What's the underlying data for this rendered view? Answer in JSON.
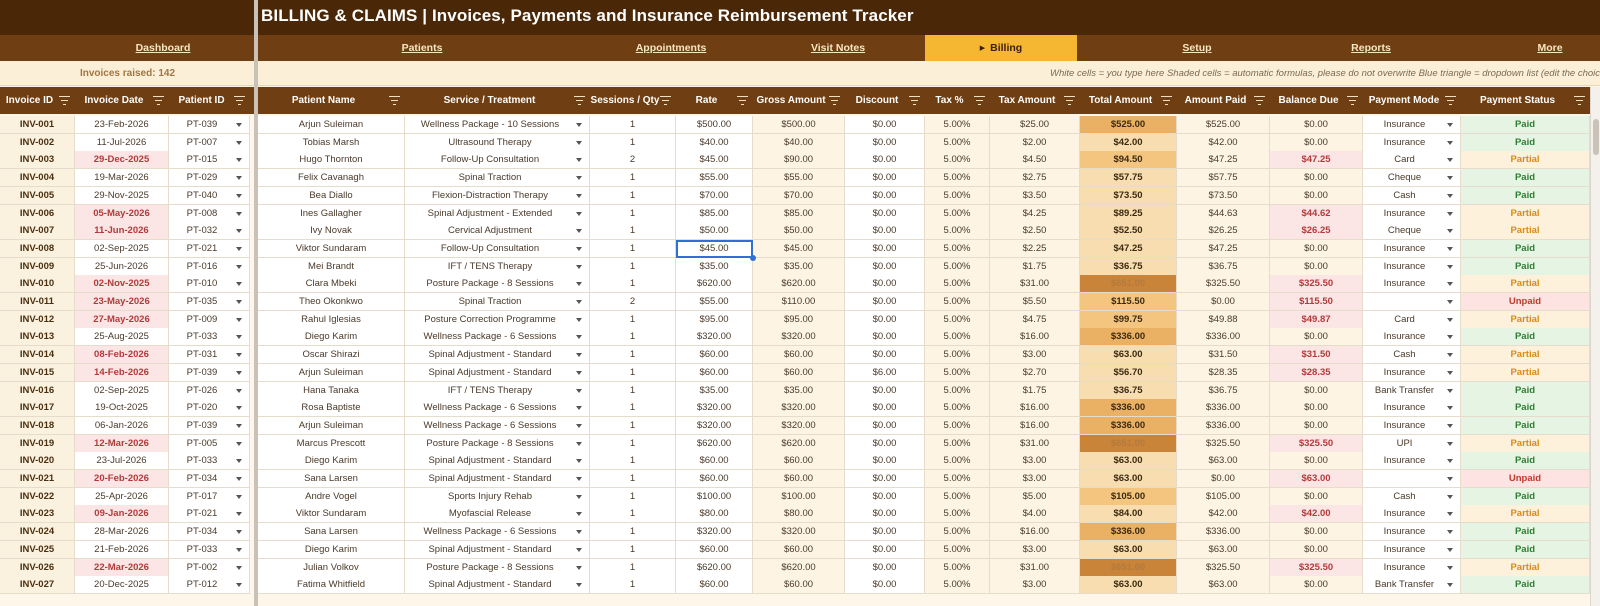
{
  "header": {
    "title": "BILLING & CLAIMS  |  Invoices, Payments and Insurance Reimbursement Tracker"
  },
  "nav": [
    {
      "label": "Dashboard",
      "active": false
    },
    {
      "label": "Patients",
      "active": false
    },
    {
      "label": "Appointments",
      "active": false
    },
    {
      "label": "Visit Notes",
      "active": false
    },
    {
      "label": "Billing",
      "active": true
    },
    {
      "label": "Setup",
      "active": false
    },
    {
      "label": "Reports",
      "active": false
    },
    {
      "label": "More",
      "active": false
    }
  ],
  "info": {
    "invoices_raised": "Invoices raised: 142",
    "legend": "White cells = you type here      Shaded cells = automatic formulas, please do not overwrite      Blue triangle = dropdown list (edit the choic"
  },
  "columns": [
    "Invoice ID",
    "Invoice Date",
    "Patient ID",
    "Patient Name",
    "Service / Treatment",
    "Sessions / Qty",
    "Rate",
    "Gross Amount",
    "Discount",
    "Tax %",
    "Tax Amount",
    "Total Amount",
    "Amount Paid",
    "Balance Due",
    "Payment Mode",
    "Payment Status"
  ],
  "rows": [
    [
      "INV-001",
      "23-Feb-2026",
      "PT-039",
      "Arjun Suleiman",
      "Wellness Package - 10 Sessions",
      "1",
      "$500.00",
      "$500.00",
      "$0.00",
      "5.00%",
      "$25.00",
      "$525.00",
      "$525.00",
      "$0.00",
      "Insurance",
      "Paid"
    ],
    [
      "INV-002",
      "11-Jul-2026",
      "PT-007",
      "Tobias Marsh",
      "Ultrasound Therapy",
      "1",
      "$40.00",
      "$40.00",
      "$0.00",
      "5.00%",
      "$2.00",
      "$42.00",
      "$42.00",
      "$0.00",
      "Insurance",
      "Paid"
    ],
    [
      "INV-003",
      "29-Dec-2025",
      "PT-015",
      "Hugo Thornton",
      "Follow-Up Consultation",
      "2",
      "$45.00",
      "$90.00",
      "$0.00",
      "5.00%",
      "$4.50",
      "$94.50",
      "$47.25",
      "$47.25",
      "Card",
      "Partial"
    ],
    [
      "INV-004",
      "19-Mar-2026",
      "PT-029",
      "Felix Cavanagh",
      "Spinal Traction",
      "1",
      "$55.00",
      "$55.00",
      "$0.00",
      "5.00%",
      "$2.75",
      "$57.75",
      "$57.75",
      "$0.00",
      "Cheque",
      "Paid"
    ],
    [
      "INV-005",
      "29-Nov-2025",
      "PT-040",
      "Bea Diallo",
      "Flexion-Distraction Therapy",
      "1",
      "$70.00",
      "$70.00",
      "$0.00",
      "5.00%",
      "$3.50",
      "$73.50",
      "$73.50",
      "$0.00",
      "Cash",
      "Paid"
    ],
    [
      "INV-006",
      "05-May-2026",
      "PT-008",
      "Ines Gallagher",
      "Spinal Adjustment - Extended",
      "1",
      "$85.00",
      "$85.00",
      "$0.00",
      "5.00%",
      "$4.25",
      "$89.25",
      "$44.63",
      "$44.62",
      "Insurance",
      "Partial"
    ],
    [
      "INV-007",
      "11-Jun-2026",
      "PT-032",
      "Ivy Novak",
      "Cervical Adjustment",
      "1",
      "$50.00",
      "$50.00",
      "$0.00",
      "5.00%",
      "$2.50",
      "$52.50",
      "$26.25",
      "$26.25",
      "Cheque",
      "Partial"
    ],
    [
      "INV-008",
      "02-Sep-2025",
      "PT-021",
      "Viktor Sundaram",
      "Follow-Up Consultation",
      "1",
      "$45.00",
      "$45.00",
      "$0.00",
      "5.00%",
      "$2.25",
      "$47.25",
      "$47.25",
      "$0.00",
      "Insurance",
      "Paid"
    ],
    [
      "INV-009",
      "25-Jun-2026",
      "PT-016",
      "Mei Brandt",
      "IFT / TENS Therapy",
      "1",
      "$35.00",
      "$35.00",
      "$0.00",
      "5.00%",
      "$1.75",
      "$36.75",
      "$36.75",
      "$0.00",
      "Insurance",
      "Paid"
    ],
    [
      "INV-010",
      "02-Nov-2025",
      "PT-010",
      "Clara Mbeki",
      "Posture Package - 8 Sessions",
      "1",
      "$620.00",
      "$620.00",
      "$0.00",
      "5.00%",
      "$31.00",
      "$651.00",
      "$325.50",
      "$325.50",
      "Insurance",
      "Partial"
    ],
    [
      "INV-011",
      "23-May-2026",
      "PT-035",
      "Theo Okonkwo",
      "Spinal Traction",
      "2",
      "$55.00",
      "$110.00",
      "$0.00",
      "5.00%",
      "$5.50",
      "$115.50",
      "$0.00",
      "$115.50",
      "",
      "Unpaid"
    ],
    [
      "INV-012",
      "27-May-2026",
      "PT-009",
      "Rahul Iglesias",
      "Posture Correction Programme",
      "1",
      "$95.00",
      "$95.00",
      "$0.00",
      "5.00%",
      "$4.75",
      "$99.75",
      "$49.88",
      "$49.87",
      "Card",
      "Partial"
    ],
    [
      "INV-013",
      "25-Aug-2025",
      "PT-033",
      "Diego Karim",
      "Wellness Package - 6 Sessions",
      "1",
      "$320.00",
      "$320.00",
      "$0.00",
      "5.00%",
      "$16.00",
      "$336.00",
      "$336.00",
      "$0.00",
      "Insurance",
      "Paid"
    ],
    [
      "INV-014",
      "08-Feb-2026",
      "PT-031",
      "Oscar Shirazi",
      "Spinal Adjustment - Standard",
      "1",
      "$60.00",
      "$60.00",
      "$0.00",
      "5.00%",
      "$3.00",
      "$63.00",
      "$31.50",
      "$31.50",
      "Cash",
      "Partial"
    ],
    [
      "INV-015",
      "14-Feb-2026",
      "PT-039",
      "Arjun Suleiman",
      "Spinal Adjustment - Standard",
      "1",
      "$60.00",
      "$60.00",
      "$6.00",
      "5.00%",
      "$2.70",
      "$56.70",
      "$28.35",
      "$28.35",
      "Insurance",
      "Partial"
    ],
    [
      "INV-016",
      "02-Sep-2025",
      "PT-026",
      "Hana Tanaka",
      "IFT / TENS Therapy",
      "1",
      "$35.00",
      "$35.00",
      "$0.00",
      "5.00%",
      "$1.75",
      "$36.75",
      "$36.75",
      "$0.00",
      "Bank Transfer",
      "Paid"
    ],
    [
      "INV-017",
      "19-Oct-2025",
      "PT-020",
      "Rosa Baptiste",
      "Wellness Package - 6 Sessions",
      "1",
      "$320.00",
      "$320.00",
      "$0.00",
      "5.00%",
      "$16.00",
      "$336.00",
      "$336.00",
      "$0.00",
      "Insurance",
      "Paid"
    ],
    [
      "INV-018",
      "06-Jan-2026",
      "PT-039",
      "Arjun Suleiman",
      "Wellness Package - 6 Sessions",
      "1",
      "$320.00",
      "$320.00",
      "$0.00",
      "5.00%",
      "$16.00",
      "$336.00",
      "$336.00",
      "$0.00",
      "Insurance",
      "Paid"
    ],
    [
      "INV-019",
      "12-Mar-2026",
      "PT-005",
      "Marcus Prescott",
      "Posture Package - 8 Sessions",
      "1",
      "$620.00",
      "$620.00",
      "$0.00",
      "5.00%",
      "$31.00",
      "$651.00",
      "$325.50",
      "$325.50",
      "UPI",
      "Partial"
    ],
    [
      "INV-020",
      "23-Jul-2026",
      "PT-033",
      "Diego Karim",
      "Spinal Adjustment - Standard",
      "1",
      "$60.00",
      "$60.00",
      "$0.00",
      "5.00%",
      "$3.00",
      "$63.00",
      "$63.00",
      "$0.00",
      "Insurance",
      "Paid"
    ],
    [
      "INV-021",
      "20-Feb-2026",
      "PT-034",
      "Sana Larsen",
      "Spinal Adjustment - Standard",
      "1",
      "$60.00",
      "$60.00",
      "$0.00",
      "5.00%",
      "$3.00",
      "$63.00",
      "$0.00",
      "$63.00",
      "",
      "Unpaid"
    ],
    [
      "INV-022",
      "25-Apr-2026",
      "PT-017",
      "Andre Vogel",
      "Sports Injury Rehab",
      "1",
      "$100.00",
      "$100.00",
      "$0.00",
      "5.00%",
      "$5.00",
      "$105.00",
      "$105.00",
      "$0.00",
      "Cash",
      "Paid"
    ],
    [
      "INV-023",
      "09-Jan-2026",
      "PT-021",
      "Viktor Sundaram",
      "Myofascial Release",
      "1",
      "$80.00",
      "$80.00",
      "$0.00",
      "5.00%",
      "$4.00",
      "$84.00",
      "$42.00",
      "$42.00",
      "Insurance",
      "Partial"
    ],
    [
      "INV-024",
      "28-Mar-2026",
      "PT-034",
      "Sana Larsen",
      "Wellness Package - 6 Sessions",
      "1",
      "$320.00",
      "$320.00",
      "$0.00",
      "5.00%",
      "$16.00",
      "$336.00",
      "$336.00",
      "$0.00",
      "Insurance",
      "Paid"
    ],
    [
      "INV-025",
      "21-Feb-2026",
      "PT-033",
      "Diego Karim",
      "Spinal Adjustment - Standard",
      "1",
      "$60.00",
      "$60.00",
      "$0.00",
      "5.00%",
      "$3.00",
      "$63.00",
      "$63.00",
      "$0.00",
      "Insurance",
      "Paid"
    ],
    [
      "INV-026",
      "22-Mar-2026",
      "PT-002",
      "Julian Volkov",
      "Posture Package - 8 Sessions",
      "1",
      "$620.00",
      "$620.00",
      "$0.00",
      "5.00%",
      "$31.00",
      "$651.00",
      "$325.50",
      "$325.50",
      "Insurance",
      "Partial"
    ],
    [
      "INV-027",
      "20-Dec-2025",
      "PT-012",
      "Fatima Whitfield",
      "Spinal Adjustment - Standard",
      "1",
      "$60.00",
      "$60.00",
      "$0.00",
      "5.00%",
      "$3.00",
      "$63.00",
      "$63.00",
      "$0.00",
      "Bank Transfer",
      "Paid"
    ]
  ],
  "selected_cell": {
    "row": 7,
    "col": 6
  },
  "colors": {
    "title_bg": "#4a2807",
    "nav_bg": "#6f3e12",
    "nav_active": "#f5b731",
    "paid": "#2e7d32",
    "partial": "#d98a16",
    "unpaid": "#c0392b",
    "overdue": "#b33a3a"
  }
}
